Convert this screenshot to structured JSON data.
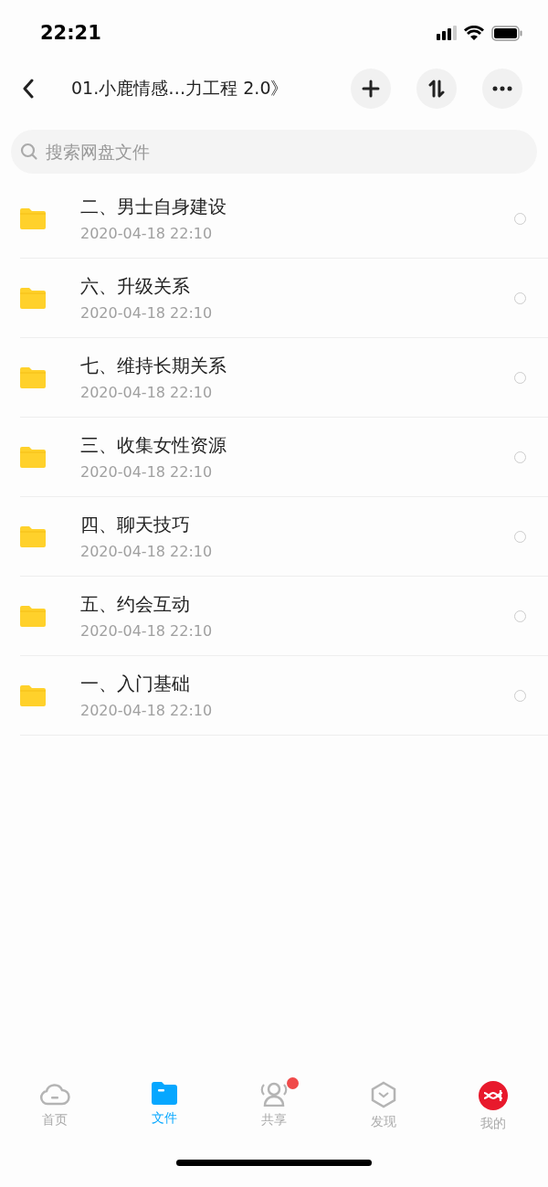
{
  "status_bar": {
    "time": "22:21"
  },
  "header": {
    "title": "01.小鹿情感…力工程 2.0》"
  },
  "search": {
    "placeholder": "搜索网盘文件"
  },
  "files": [
    {
      "name": "二、男士自身建设",
      "date": "2020-04-18 22:10",
      "checked": false
    },
    {
      "name": "六、升级关系",
      "date": "2020-04-18 22:10",
      "checked": false
    },
    {
      "name": "七、维持长期关系",
      "date": "2020-04-18 22:10",
      "checked": false
    },
    {
      "name": "三、收集女性资源",
      "date": "2020-04-18 22:10",
      "checked": false
    },
    {
      "name": "四、聊天技巧",
      "date": "2020-04-18 22:10",
      "checked": false
    },
    {
      "name": "五、约会互动",
      "date": "2020-04-18 22:10",
      "checked": false
    },
    {
      "name": "一、入门基础",
      "date": "2020-04-18 22:10",
      "checked": false
    }
  ],
  "tabs": [
    {
      "kind": "home",
      "label": "首页",
      "selected": false,
      "badge": false
    },
    {
      "kind": "files",
      "label": "文件",
      "selected": true,
      "badge": false
    },
    {
      "kind": "share",
      "label": "共享",
      "selected": false,
      "badge": true
    },
    {
      "kind": "discover",
      "label": "发现",
      "selected": false,
      "badge": false
    },
    {
      "kind": "me",
      "label": "我的",
      "selected": false,
      "badge": false
    }
  ]
}
